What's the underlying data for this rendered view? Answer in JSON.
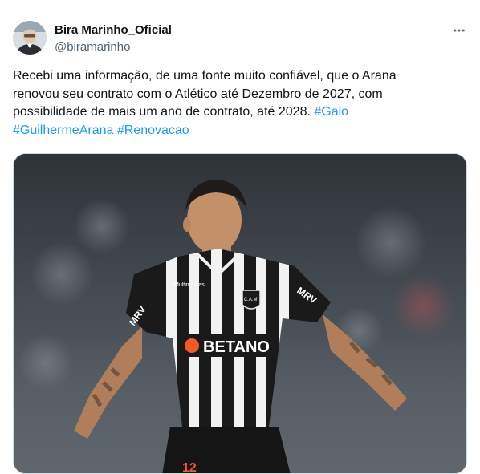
{
  "author": {
    "display_name": "Bira Marinho_Oficial",
    "handle": "@biramarinho"
  },
  "more_icon": "more-horizontal-icon",
  "tweet": {
    "text_lines": [
      "Recebi uma informação, de uma fonte muito confiável, que o Arana",
      "renovou seu contrato com o Atlético até Dezembro de 2027, com",
      "possibilidade de mais um ano de contrato, até 2028."
    ],
    "hashtags": [
      "#Galo",
      "#GuilhermeArana",
      "#Renovacao"
    ]
  },
  "media": {
    "shirt_sponsor": "BETANO",
    "shirt_sleeve": "MRV",
    "shirt_crest": "C.A.M.",
    "shirt_number": "12",
    "shirt_maker": "Multimarcas",
    "colors": {
      "stripe_dark": "#1a1a1a",
      "stripe_light": "#f2f2f2",
      "sponsor_orange": "#f05a28",
      "link": "#1d9bf0"
    }
  }
}
